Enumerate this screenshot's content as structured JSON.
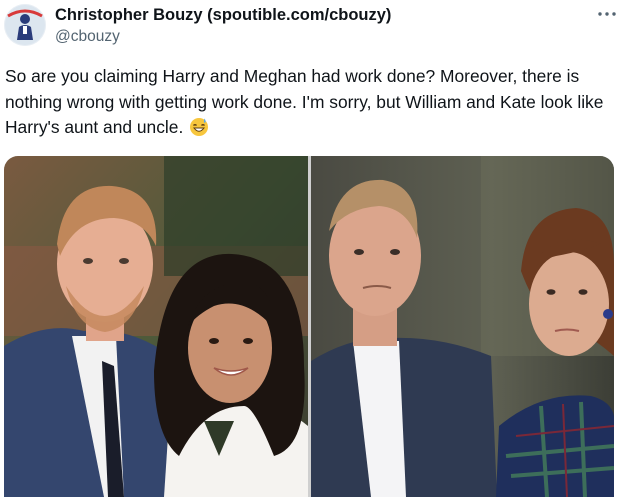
{
  "tweet": {
    "author_name": "Christopher Bouzy (spoutible.com/cbouzy)",
    "author_handle": "@cbouzy",
    "more_icon": "more-horizontal-icon",
    "text": "So are you claiming Harry and Meghan had work done? Moreover, there is nothing wrong with getting work done. I'm sorry, but William and Kate look like Harry's aunt and uncle.",
    "emoji": "grinning-face-with-sweat-emoji"
  },
  "colors": {
    "text_primary": "#0f1419",
    "text_secondary": "#536471",
    "emoji": "#f7c63d"
  }
}
